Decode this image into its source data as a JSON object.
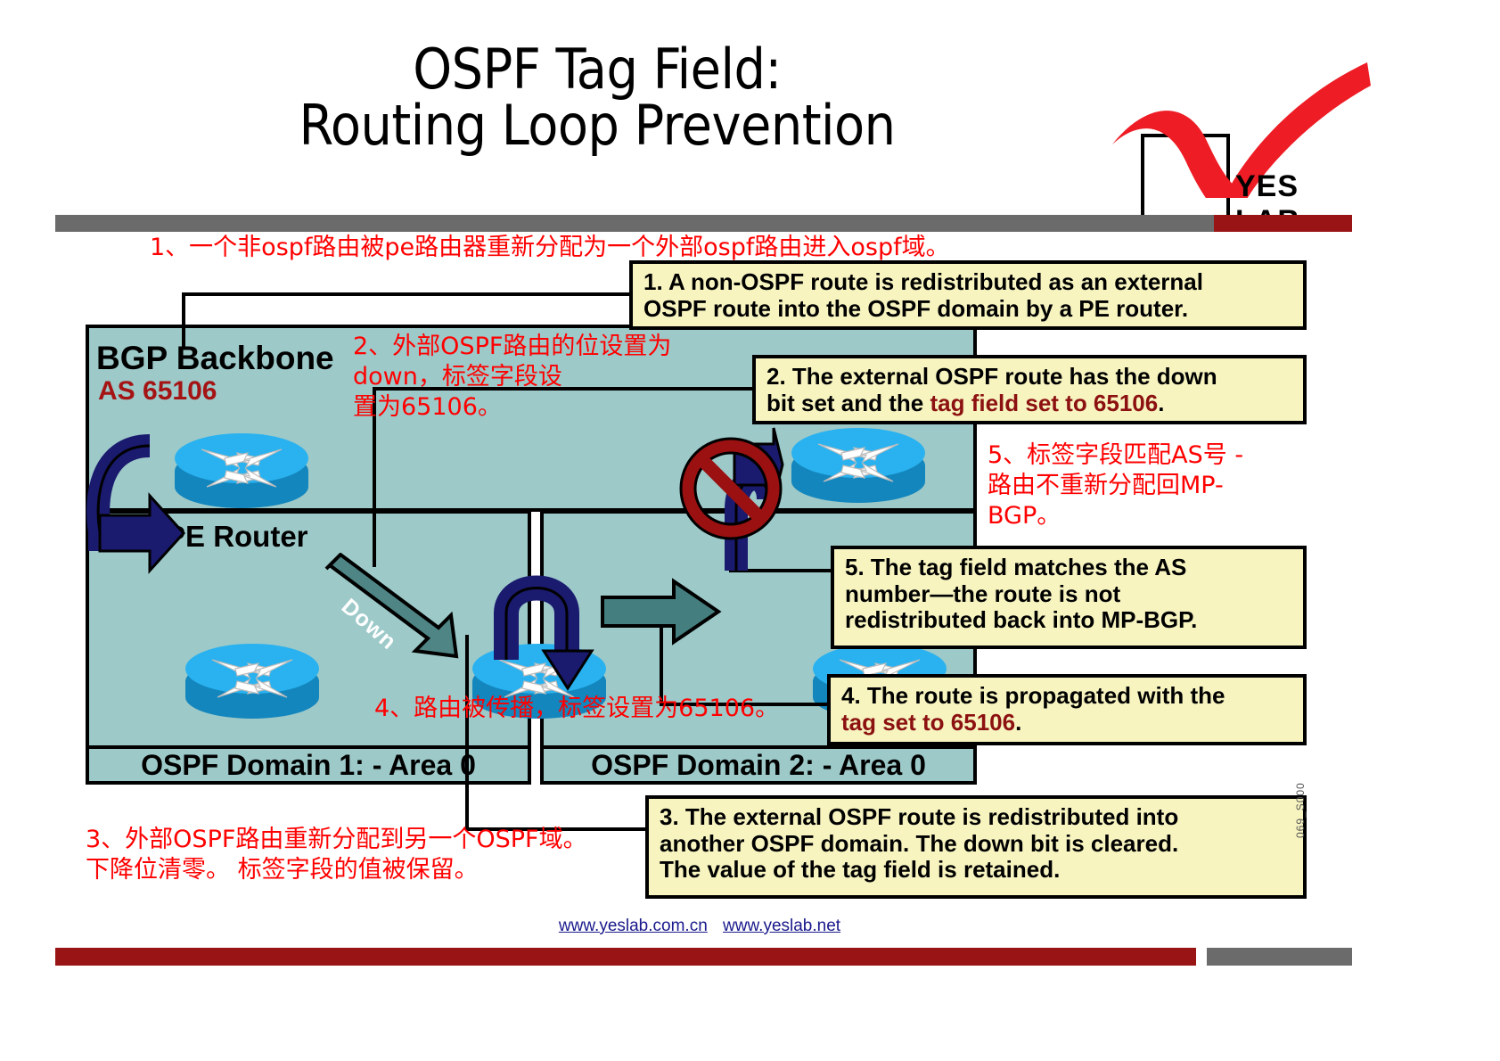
{
  "title": {
    "line1": "OSPF Tag Field:",
    "line2": "Routing Loop Prevention"
  },
  "logo": {
    "text": "YES LAB",
    "accent_color": "#ee1c25"
  },
  "diagram": {
    "bgp_backbone_label": "BGP Backbone",
    "as_label": "AS 65106",
    "pe_router_label": "PE Router",
    "down_arrow_label": "Down",
    "domain1_label": "OSPF Domain 1: - Area 0",
    "domain2_label": "OSPF Domain 2: - Area 0",
    "region_fill": "#9dc9c9",
    "router_top_color": "#29b2ef",
    "router_body_color": "#1386bd",
    "arrow_color": "#1a1a6e",
    "noentry_color": "#9b1111"
  },
  "callouts": [
    {
      "id": "co1",
      "line1": "1. A non-OSPF route is redistributed as an external",
      "line2": "OSPF route into the OSPF domain by a PE router."
    },
    {
      "id": "co2",
      "line1_a": "2. The external OSPF route has the down",
      "line2_a": "bit set and the ",
      "line2_hi": "tag field set to 65106",
      "line2_b": "."
    },
    {
      "id": "co5",
      "line1": "5. The tag field matches the AS",
      "line2": "number—the route is not",
      "line3": "redistributed back into MP-BGP."
    },
    {
      "id": "co4",
      "line1": "4. The route is propagated with the",
      "line2_hi": "tag set to 65106",
      "line2_b": "."
    },
    {
      "id": "co3",
      "line1": "3. The external OSPF route is redistributed into",
      "line2": "another OSPF domain. The down bit is cleared.",
      "line3": "The value of the tag field is retained."
    }
  ],
  "annotations_cn": {
    "n1": "1、一个非ospf路由被pe路由器重新分配为一个外部ospf路由进入ospf域。",
    "n2": "2、外部OSPF路由的位设置为down，标签字段设\n置为65106。",
    "n5": "5、标签字段匹配AS号 -\n路由不重新分配回MP-\nBGP。",
    "n4": "4、路由被传播，标签设置为65106。",
    "n3": "3、外部OSPF路由重新分配到另一个OSPF域。\n下降位清零。 标签字段的值被保留。"
  },
  "footer": {
    "link1": "www.yeslab.com.cn",
    "link2": "www.yeslab.net",
    "side_code": "069_S000"
  }
}
